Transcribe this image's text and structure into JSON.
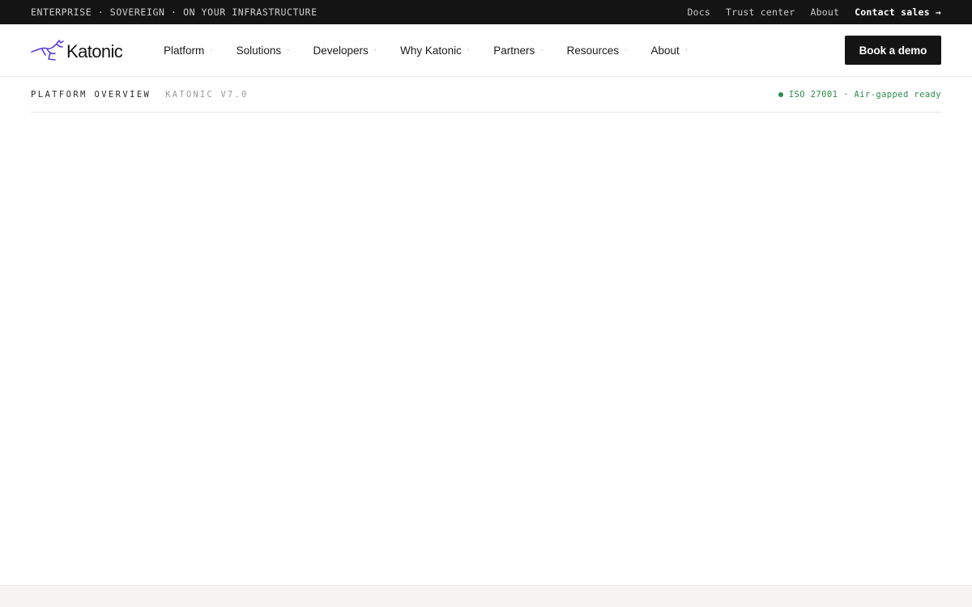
{
  "topbar": {
    "tagline": "ENTERPRISE · SOVEREIGN · ON YOUR INFRASTRUCTURE",
    "links": [
      {
        "label": "Docs"
      },
      {
        "label": "Trust center"
      },
      {
        "label": "About"
      },
      {
        "label": "Contact sales →"
      }
    ]
  },
  "nav": {
    "logo_text": "Katonic",
    "logo_icon": "kangaroo-logo-icon",
    "items": [
      {
        "label": "Platform"
      },
      {
        "label": "Solutions"
      },
      {
        "label": "Developers"
      },
      {
        "label": "Why Katonic"
      },
      {
        "label": "Partners"
      },
      {
        "label": "Resources"
      },
      {
        "label": "About"
      }
    ],
    "item_separator": "·",
    "cta_label": "Book a demo"
  },
  "subheader": {
    "section_label": "PLATFORM OVERVIEW",
    "version_label": "KATONIC V7.0",
    "status_text": "ISO 27001 · Air-gapped ready"
  },
  "colors": {
    "topbar_bg": "#141414",
    "cta_bg": "#141414",
    "logo_accent": "#5b3fd6",
    "status_green": "#2f8a4e",
    "footer_band": "#f5f4f1"
  }
}
